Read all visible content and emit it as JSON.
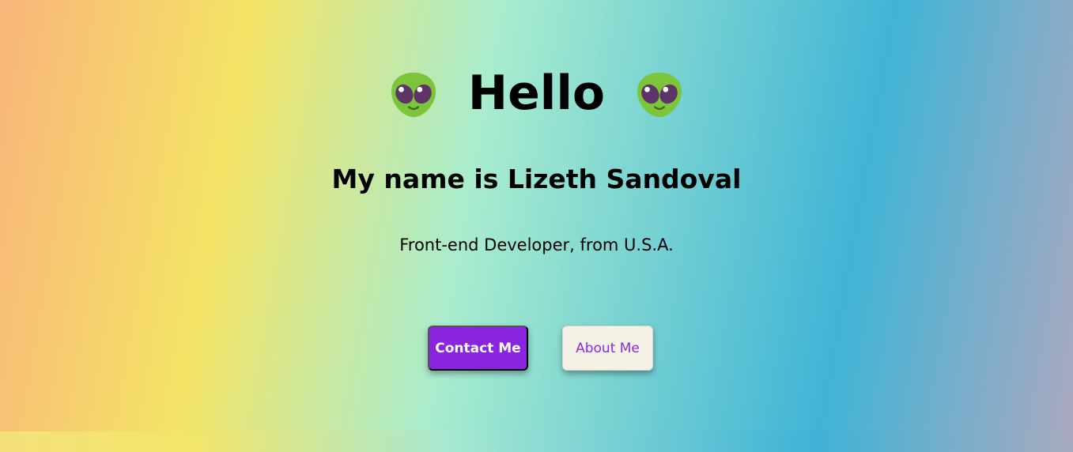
{
  "header": {
    "title": "Hello",
    "left_icon": "alien-emoji-icon",
    "right_icon": "alien-emoji-icon"
  },
  "intro": {
    "name_line": "My name is Lizeth Sandoval",
    "tagline": "Front-end Developer, from U.S.A."
  },
  "actions": {
    "contact_label": "Contact Me",
    "about_label": "About Me"
  },
  "colors": {
    "primary_button": "#8a24e0",
    "secondary_button": "#f4f1e7",
    "secondary_text": "#8a2be2",
    "alien_green": "#7cc53a",
    "alien_eye": "#5c3566"
  }
}
